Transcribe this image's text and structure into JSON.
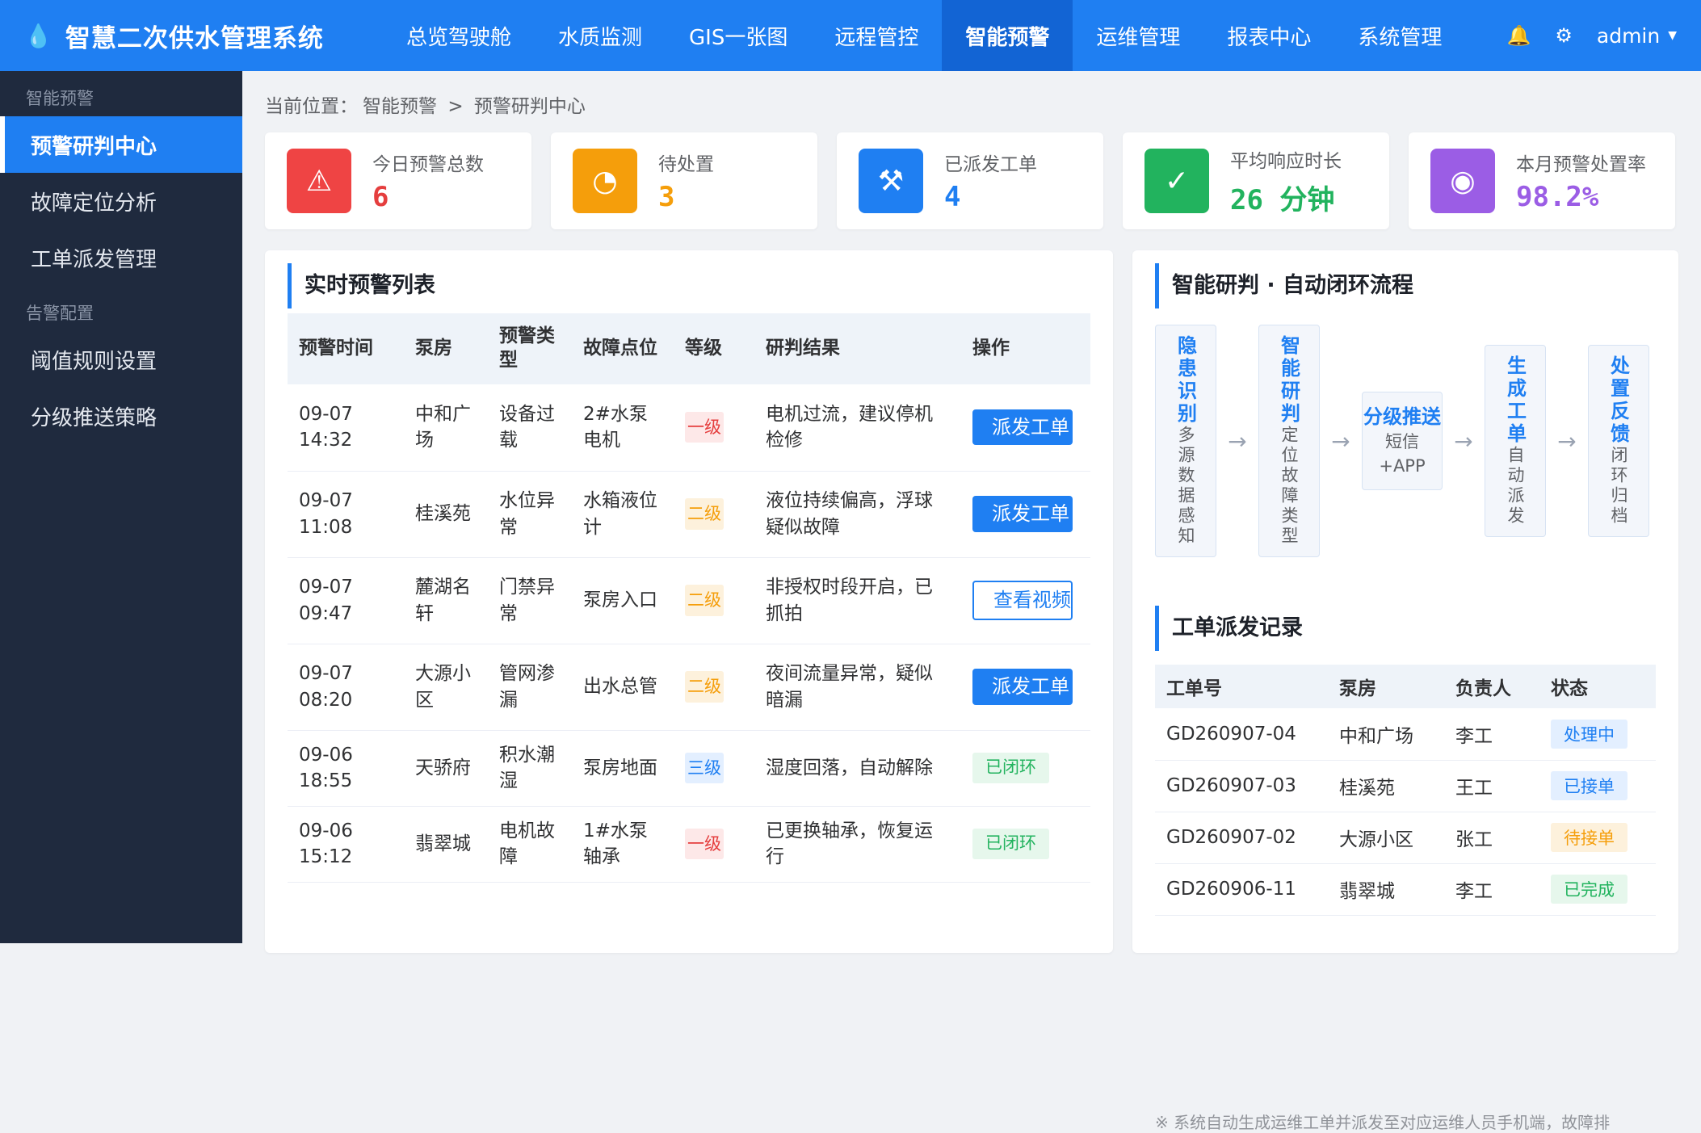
{
  "header": {
    "title": "智慧二次供水管理系统",
    "logo_icon": "water-drop-icon",
    "nav": [
      {
        "label": "总览驾驶舱"
      },
      {
        "label": "水质监测"
      },
      {
        "label": "GIS一张图"
      },
      {
        "label": "远程管控"
      },
      {
        "label": "智能预警",
        "active": true
      },
      {
        "label": "运维管理"
      },
      {
        "label": "报表中心"
      },
      {
        "label": "系统管理"
      }
    ],
    "user": "admin"
  },
  "sidebar": {
    "groups": [
      {
        "label": "智能预警",
        "items": [
          {
            "label": "预警研判中心",
            "active": true
          },
          {
            "label": "故障定位分析"
          },
          {
            "label": "工单派发管理"
          }
        ]
      },
      {
        "label": "告警配置",
        "items": [
          {
            "label": "阈值规则设置"
          },
          {
            "label": "分级推送策略"
          }
        ]
      }
    ]
  },
  "breadcrumb": {
    "prefix": "当前位置：",
    "path1": "智能预警",
    "sep": ">",
    "path2": "预警研判中心"
  },
  "stats": [
    {
      "label": "今日预警总数",
      "value": "6",
      "color": "#e53e3e",
      "icon_bg": "#ef4444",
      "icon": "warning-icon"
    },
    {
      "label": "待处置",
      "value": "3",
      "color": "#f59e0b",
      "icon_bg": "#f59e0b",
      "icon": "pie-icon"
    },
    {
      "label": "已派发工单",
      "value": "4",
      "color": "#1f7ff2",
      "icon_bg": "#1f7ff2",
      "icon": "tools-icon"
    },
    {
      "label": "平均响应时长",
      "value": "26 分钟",
      "color": "#22b35e",
      "icon_bg": "#22b35e",
      "icon": "check-icon"
    },
    {
      "label": "本月预警处置率",
      "value": "98.2%",
      "color": "#9b5de5",
      "icon_bg": "#9b5de5",
      "icon": "target-icon"
    }
  ],
  "alerts": {
    "title": "实时预警列表",
    "columns": [
      "预警时间",
      "泵房",
      "预警类型",
      "故障点位",
      "等级",
      "研判结果",
      "操作"
    ],
    "rows": [
      {
        "date": "09-07",
        "time": "14:32",
        "room": "中和广场",
        "type": "设备过载",
        "point": "2#水泵电机",
        "level": "一级",
        "level_class": "lvl-1",
        "result": "电机过流，建议停机检修",
        "action": "派发工单",
        "action_type": "primary"
      },
      {
        "date": "09-07",
        "time": "11:08",
        "room": "桂溪苑",
        "type": "水位异常",
        "point": "水箱液位计",
        "level": "二级",
        "level_class": "lvl-2",
        "result": "液位持续偏高，浮球疑似故障",
        "action": "派发工单",
        "action_type": "primary"
      },
      {
        "date": "09-07",
        "time": "09:47",
        "room": "麓湖名轩",
        "type": "门禁异常",
        "point": "泵房入口",
        "level": "二级",
        "level_class": "lvl-2",
        "result": "非授权时段开启，已抓拍",
        "action": "查看视频",
        "action_type": "outline"
      },
      {
        "date": "09-07",
        "time": "08:20",
        "room": "大源小区",
        "type": "管网渗漏",
        "point": "出水总管",
        "level": "二级",
        "level_class": "lvl-2",
        "result": "夜间流量异常，疑似暗漏",
        "action": "派发工单",
        "action_type": "primary"
      },
      {
        "date": "09-06",
        "time": "18:55",
        "room": "天骄府",
        "type": "积水潮湿",
        "point": "泵房地面",
        "level": "三级",
        "level_class": "lvl-3",
        "result": "湿度回落，自动解除",
        "action": "已闭环",
        "action_type": "closed"
      },
      {
        "date": "09-06",
        "time": "15:12",
        "room": "翡翠城",
        "type": "电机故障",
        "point": "1#水泵轴承",
        "level": "一级",
        "level_class": "lvl-1",
        "result": "已更换轴承，恢复运行",
        "action": "已闭环",
        "action_type": "closed"
      }
    ]
  },
  "flow": {
    "title": "智能研判 · 自动闭环流程",
    "steps": [
      {
        "title": "隐患识别",
        "desc": "多源数据感知"
      },
      {
        "title": "智能研判",
        "desc": "定位故障类型"
      },
      {
        "title": "分级推送",
        "desc": "短信+APP",
        "horizontal": true
      },
      {
        "title": "生成工单",
        "desc": "自动派发"
      },
      {
        "title": "处置反馈",
        "desc": "闭环归档"
      }
    ],
    "arrow": "→"
  },
  "workorders": {
    "title": "工单派发记录",
    "columns": [
      "工单号",
      "泵房",
      "负责人",
      "状态"
    ],
    "rows": [
      {
        "id": "GD260907-04",
        "room": "中和广场",
        "owner": "李工",
        "status": "处理中",
        "status_class": "st-processing"
      },
      {
        "id": "GD260907-03",
        "room": "桂溪苑",
        "owner": "王工",
        "status": "已接单",
        "status_class": "st-accepted"
      },
      {
        "id": "GD260907-02",
        "room": "大源小区",
        "owner": "张工",
        "status": "待接单",
        "status_class": "st-pending"
      },
      {
        "id": "GD260906-11",
        "room": "翡翠城",
        "owner": "李工",
        "status": "已完成",
        "status_class": "st-done"
      }
    ],
    "note": "※ 系统自动生成运维工单并派发至对应运维人员手机端，故障排"
  }
}
